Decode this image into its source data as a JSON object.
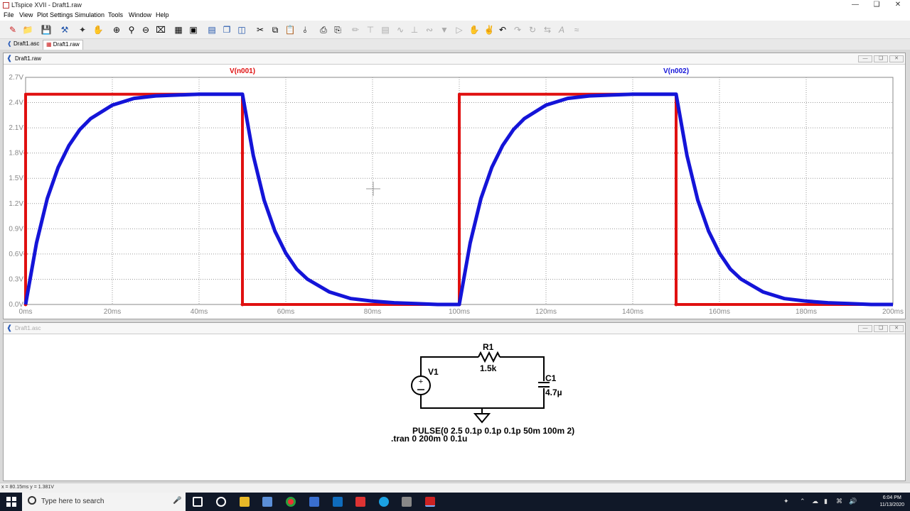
{
  "window": {
    "title": "LTspice XVII - Draft1.raw"
  },
  "menu": [
    "File",
    "View",
    "Plot Settings",
    "Simulation",
    "Tools",
    "Window",
    "Help"
  ],
  "tabs": [
    {
      "label": "Draft1.asc"
    },
    {
      "label": "Draft1.raw"
    }
  ],
  "plot_window": {
    "title": "Draft1.raw",
    "trace_labels": [
      "V(n001)",
      "V(n002)"
    ],
    "trace_colors": [
      "#e01010",
      "#1414d8"
    ]
  },
  "chart_data": {
    "type": "line",
    "xlabel": "",
    "ylabel": "",
    "xlim": [
      0,
      200
    ],
    "ylim": [
      0,
      2.7
    ],
    "x_ticks": [
      "0ms",
      "20ms",
      "40ms",
      "60ms",
      "80ms",
      "100ms",
      "120ms",
      "140ms",
      "160ms",
      "180ms",
      "200ms"
    ],
    "y_ticks": [
      "0.0V",
      "0.3V",
      "0.6V",
      "0.9V",
      "1.2V",
      "1.5V",
      "1.8V",
      "2.1V",
      "2.4V",
      "2.7V"
    ],
    "grid": true,
    "series": [
      {
        "name": "V(n001)",
        "color": "#e01010",
        "x": [
          0,
          0,
          50,
          50,
          100,
          100,
          150,
          150,
          200
        ],
        "y": [
          0,
          2.5,
          2.5,
          0,
          0,
          2.5,
          2.5,
          0,
          0
        ]
      },
      {
        "name": "V(n002)",
        "color": "#1414d8",
        "x": [
          0,
          2.5,
          5,
          7.5,
          10,
          12.5,
          15,
          20,
          25,
          30,
          35,
          40,
          45,
          50,
          52.5,
          55,
          57.5,
          60,
          62.5,
          65,
          70,
          75,
          80,
          85,
          90,
          95,
          100,
          102.5,
          105,
          107.5,
          110,
          112.5,
          115,
          120,
          125,
          130,
          135,
          140,
          145,
          150,
          152.5,
          155,
          157.5,
          160,
          162.5,
          165,
          170,
          175,
          180,
          185,
          190,
          195,
          200
        ],
        "y": [
          0,
          0.73,
          1.26,
          1.63,
          1.89,
          2.08,
          2.21,
          2.37,
          2.45,
          2.48,
          2.49,
          2.5,
          2.5,
          2.5,
          1.77,
          1.24,
          0.87,
          0.61,
          0.42,
          0.3,
          0.15,
          0.07,
          0.04,
          0.02,
          0.01,
          0.0,
          0.0,
          0.73,
          1.26,
          1.63,
          1.89,
          2.08,
          2.21,
          2.37,
          2.45,
          2.48,
          2.49,
          2.5,
          2.5,
          2.5,
          1.77,
          1.24,
          0.87,
          0.61,
          0.42,
          0.3,
          0.15,
          0.07,
          0.04,
          0.02,
          0.01,
          0.0,
          0.0
        ]
      }
    ]
  },
  "schematic_window": {
    "title": "Draft1.asc",
    "components": {
      "r1_name": "R1",
      "r1_value": "1.5k",
      "c1_name": "C1",
      "c1_value": "4.7µ",
      "v1_name": "V1"
    },
    "pulse_directive": "PULSE(0 2.5 0.1p 0.1p 0.1p 50m 100m 2)",
    "tran_directive": ".tran 0 200m 0 0.1u"
  },
  "status": {
    "cursor": "x = 80.15ms    y = 1.381V"
  },
  "taskbar": {
    "search_placeholder": "Type here to search",
    "time": "6:04 PM",
    "date": "11/13/2020"
  }
}
